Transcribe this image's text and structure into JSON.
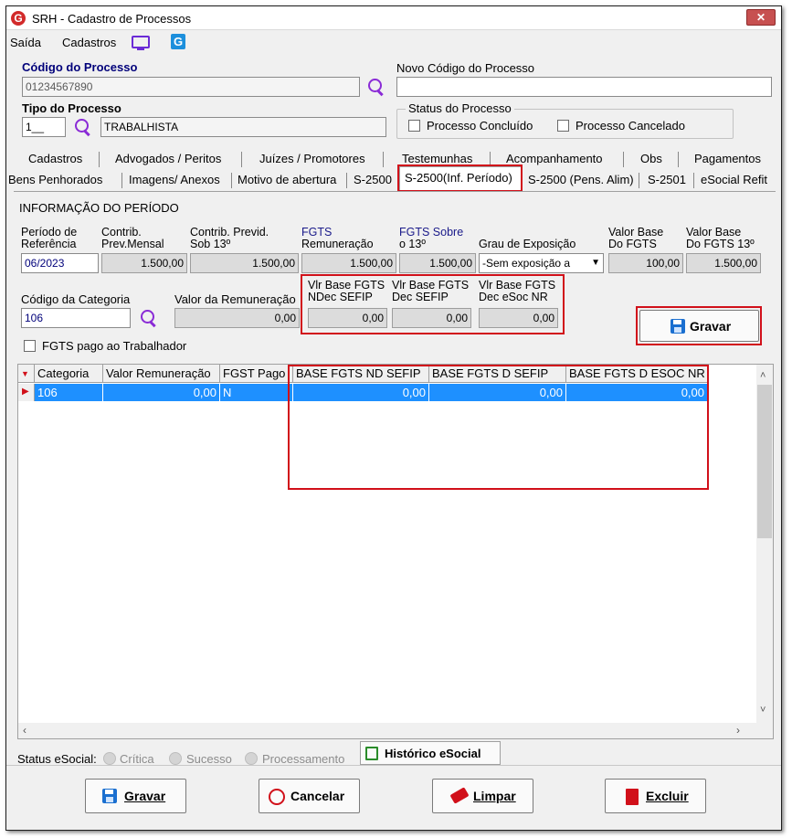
{
  "window": {
    "title": "SRH - Cadastro de Processos",
    "close": "✕"
  },
  "menu": {
    "saida": "Saída",
    "cadastros": "Cadastros"
  },
  "processo": {
    "codigo_label": "Código do Processo",
    "codigo_value": "01234567890",
    "novo_codigo_label": "Novo Código do Processo",
    "novo_codigo_value": "",
    "tipo_label": "Tipo do Processo",
    "tipo_code": "1__",
    "tipo_name": "TRABALHISTA",
    "status_label": "Status do Processo",
    "concluido_label": "Processo Concluído",
    "cancelado_label": "Processo Cancelado"
  },
  "tabs_row1": [
    "Cadastros",
    "Advogados / Peritos",
    "Juízes / Promotores",
    "Testemunhas",
    "Acompanhamento",
    "Obs",
    "Pagamentos"
  ],
  "tabs_row2": [
    "Bens Penhorados",
    "Imagens/ Anexos",
    "Motivo de abertura",
    "S-2500",
    "S-2500(Inf. Período)",
    "S-2500 (Pens. Alim)",
    "S-2501",
    "eSocial Refit"
  ],
  "periodo": {
    "section_title": "INFORMAÇÃO DO PERÍODO",
    "ref_label_1": "Período de",
    "ref_label_2": "Referência",
    "ref_value": "06/2023",
    "contrib_label_1": "Contrib.",
    "contrib_label_2": "Prev.Mensal",
    "contrib_value": "1.500,00",
    "contrib13_label_1": "Contrib. Previd.",
    "contrib13_label_2": "Sob 13º",
    "contrib13_value": "1.500,00",
    "fgts_label_1": "FGTS",
    "fgts_label_2": "Remuneração",
    "fgts_value": "1.500,00",
    "fgts13_label_1": "FGTS Sobre",
    "fgts13_label_2": "o 13º",
    "fgts13_value": "1.500,00",
    "grau_label": "Grau de Exposição",
    "grau_value": "-Sem exposição a",
    "vbase_label_1": "Valor Base",
    "vbase_label_2": "Do FGTS",
    "vbase_value": "100,00",
    "vbase13_label_1": "Valor Base",
    "vbase13_label_2": "Do FGTS 13º",
    "vbase13_value": "1.500,00",
    "cat_label": "Código da Categoria",
    "cat_value": "106",
    "remun_label": "Valor da Remuneração",
    "remun_value": "0,00",
    "nd_label_1": "Vlr Base FGTS",
    "nd_label_2": "NDec SEFIP",
    "nd_value": "0,00",
    "dec_label_1": "Vlr Base FGTS",
    "dec_label_2": "Dec SEFIP",
    "dec_value": "0,00",
    "esoc_label_1": "Vlr Base FGTS",
    "esoc_label_2": "Dec eSoc NR",
    "esoc_value": "0,00",
    "fgts_pago_label": "FGTS pago ao Trabalhador",
    "gravar_label": "Gravar"
  },
  "grid": {
    "columns": [
      "Categoria",
      "Valor Remuneração",
      "FGST Pago",
      "BASE FGTS ND SEFIP",
      "BASE FGTS D SEFIP",
      "BASE FGTS D ESOC NR"
    ],
    "rows": [
      [
        "106",
        "0,00",
        "N",
        "0,00",
        "0,00",
        "0,00"
      ]
    ]
  },
  "status_bar": {
    "label": "Status eSocial:",
    "critica": "Crítica",
    "sucesso": "Sucesso",
    "processamento": "Processamento",
    "historico": "Histórico eSocial"
  },
  "buttons": {
    "gravar": "Gravar",
    "cancelar": "Cancelar",
    "limpar": "Limpar",
    "excluir": "Excluir"
  },
  "colors": {
    "accent_red": "#d1101a",
    "selection_blue": "#1e90ff",
    "label_blue": "#00007a"
  }
}
